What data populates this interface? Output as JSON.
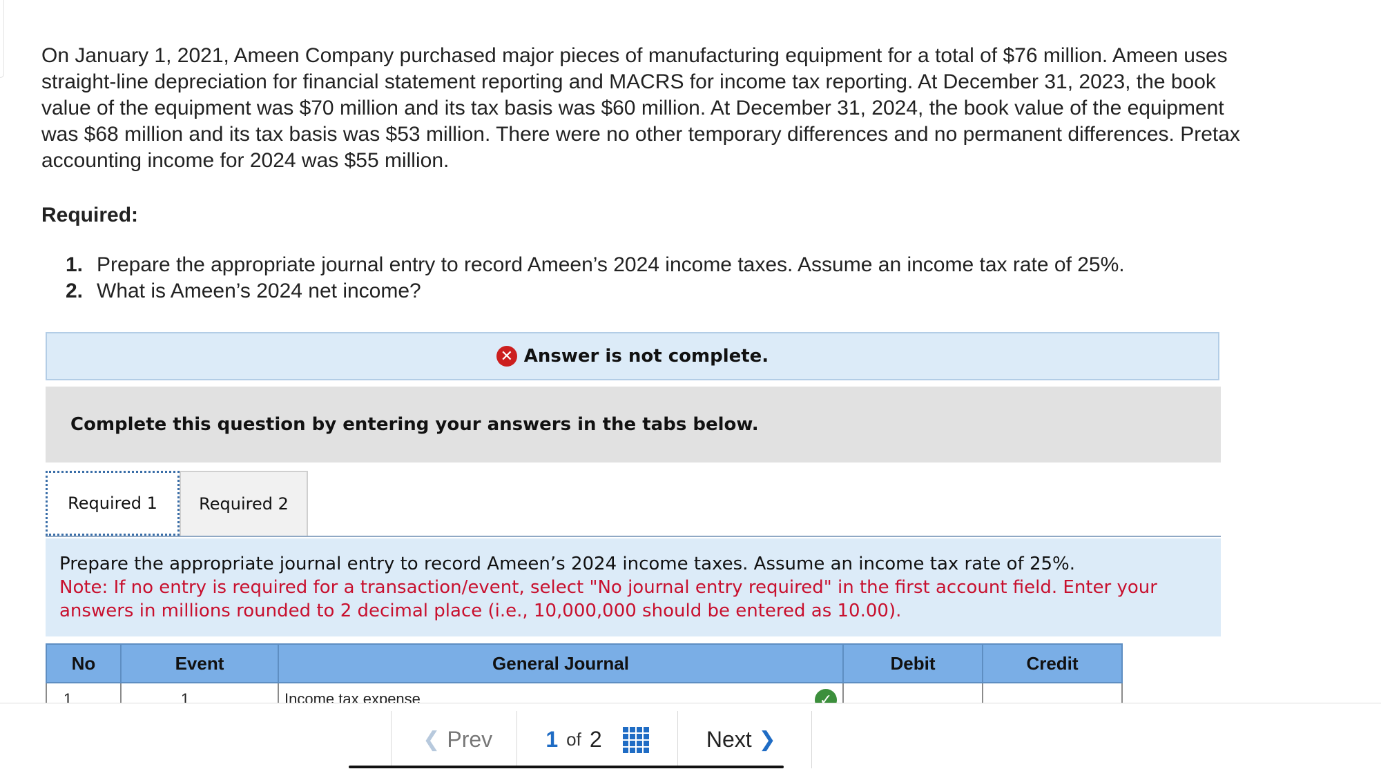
{
  "problem": {
    "text": "On January 1, 2021, Ameen Company purchased major pieces of manufacturing equipment for a total of $76 million. Ameen uses straight-line depreciation for financial statement reporting and MACRS for income tax reporting. At December 31, 2023, the book value of the equipment was $70 million and its tax basis was $60 million. At December 31, 2024, the book value of the equipment was $68 million and its tax basis was $53 million. There were no other temporary differences and no permanent differences. Pretax accounting income for 2024 was $55 million."
  },
  "required": {
    "heading": "Required:",
    "items": [
      {
        "num": "1.",
        "text": "Prepare the appropriate journal entry to record Ameen’s 2024 income taxes. Assume an income tax rate of 25%."
      },
      {
        "num": "2.",
        "text": "What is Ameen’s 2024 net income?"
      }
    ]
  },
  "status": {
    "icon": "x-icon",
    "message": "Answer is not complete."
  },
  "instructions": "Complete this question by entering your answers in the tabs below.",
  "tabs": [
    {
      "label": "Required 1",
      "active": true
    },
    {
      "label": "Required 2",
      "active": false
    }
  ],
  "prompt": {
    "main": "Prepare the appropriate journal entry to record Ameen’s 2024 income taxes. Assume an income tax rate of 25%.",
    "note": "Note: If no entry is required for a transaction/event, select \"No journal entry required\" in the first account field. Enter your answers in millions rounded to 2 decimal place (i.e., 10,000,000 should be entered as 10.00)."
  },
  "journal": {
    "headers": [
      "No",
      "Event",
      "General Journal",
      "Debit",
      "Credit"
    ],
    "rows": [
      {
        "no": "1",
        "event": "1",
        "account": "Income tax expense",
        "debit": "",
        "credit": ""
      }
    ]
  },
  "pager": {
    "prev": "Prev",
    "current": "1",
    "of": "of",
    "total": "2",
    "next": "Next"
  },
  "colors": {
    "header_blue": "#7aaee6",
    "panel_blue": "#dcebf8",
    "note_red": "#c8102e",
    "error_red": "#cc1f1f",
    "check_green": "#3c8f3c",
    "link_blue": "#1f6cc4"
  }
}
